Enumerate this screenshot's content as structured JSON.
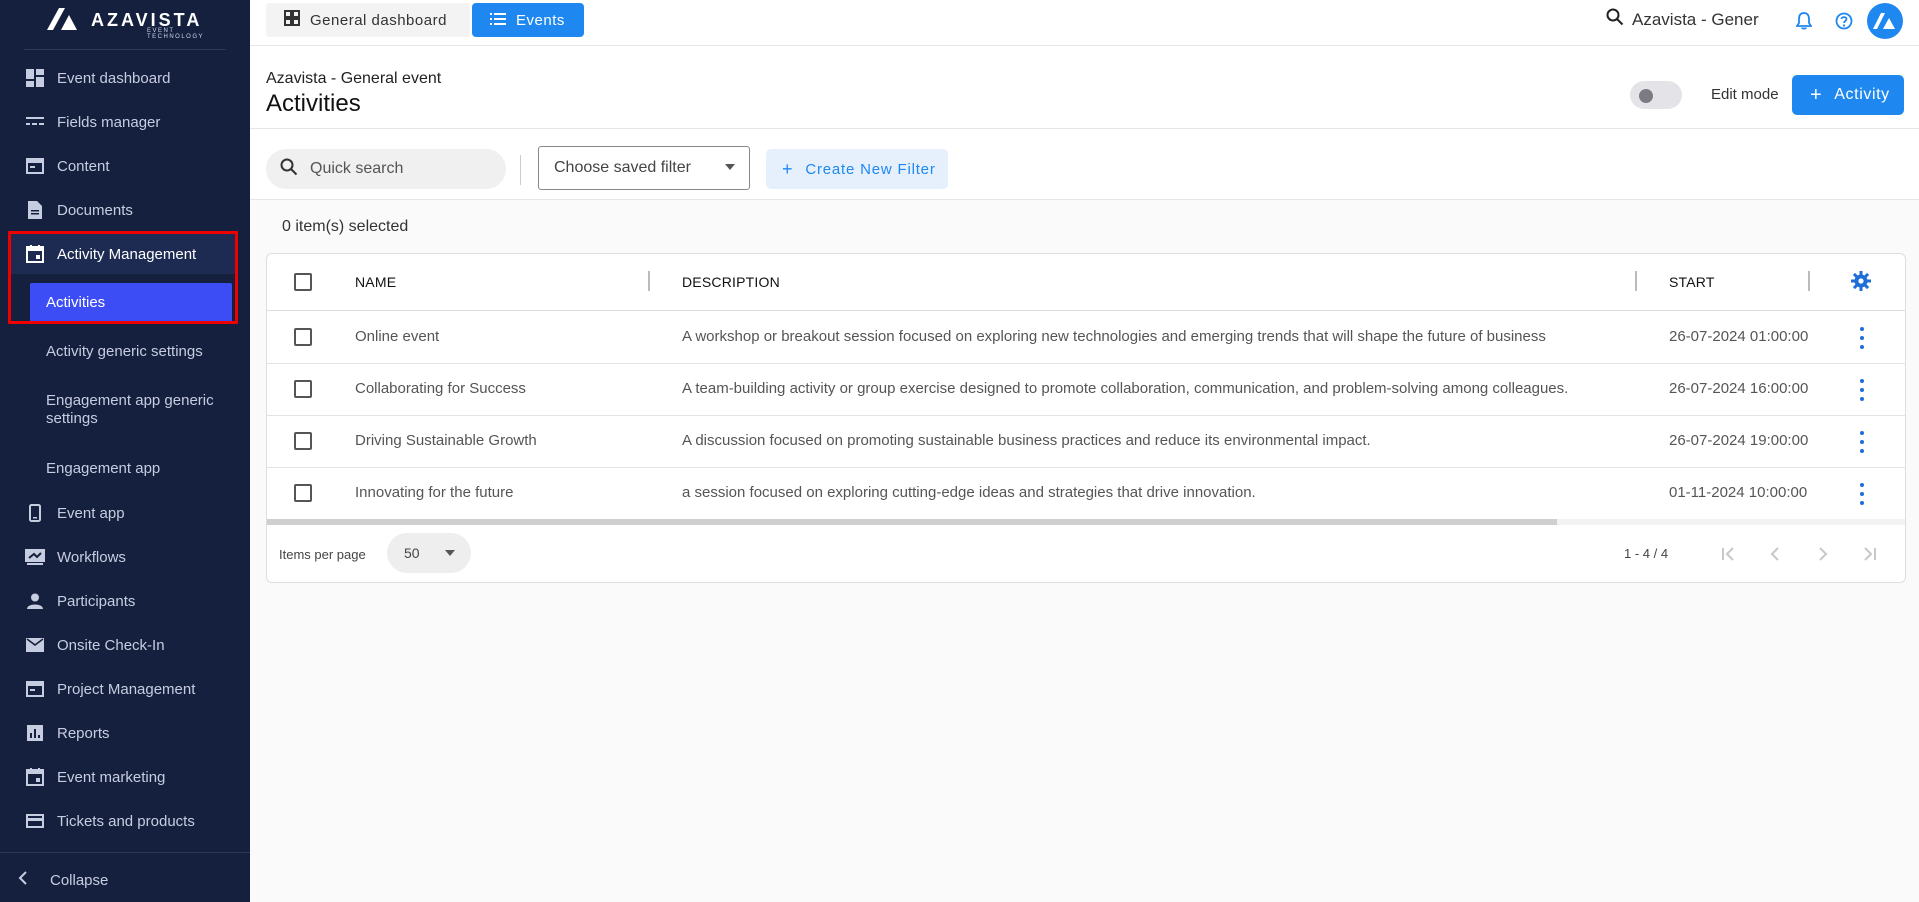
{
  "logo": {
    "word": "AZAVISTA",
    "sub": "EVENT TECHNOLOGY"
  },
  "sidebar": {
    "items": [
      {
        "label": "Event dashboard",
        "icon": "dashboard-icon"
      },
      {
        "label": "Fields manager",
        "icon": "fields-icon"
      },
      {
        "label": "Content",
        "icon": "content-icon"
      },
      {
        "label": "Documents",
        "icon": "document-icon"
      },
      {
        "label": "Activity Management",
        "icon": "calendar-icon"
      },
      {
        "label": "Event app",
        "icon": "phone-icon"
      },
      {
        "label": "Workflows",
        "icon": "workflow-icon"
      },
      {
        "label": "Participants",
        "icon": "person-icon"
      },
      {
        "label": "Onsite Check-In",
        "icon": "mail-icon"
      },
      {
        "label": "Project Management",
        "icon": "project-icon"
      },
      {
        "label": "Reports",
        "icon": "chart-icon"
      },
      {
        "label": "Event marketing",
        "icon": "calendar-icon"
      },
      {
        "label": "Tickets and products",
        "icon": "card-icon"
      }
    ],
    "sub_items": [
      {
        "label": "Activities"
      },
      {
        "label": "Activity generic settings"
      },
      {
        "label": "Engagement app generic settings"
      },
      {
        "label": "Engagement app"
      }
    ],
    "collapse_label": "Collapse"
  },
  "topbar": {
    "general_tab": "General dashboard",
    "events_tab": "Events",
    "search_text": "Azavista - Gener"
  },
  "header": {
    "event_name": "Azavista - General event",
    "title": "Activities",
    "edit_mode_label": "Edit mode",
    "add_button_label": "Activity"
  },
  "filters": {
    "search_placeholder": "Quick search",
    "saved_filter_placeholder": "Choose saved filter",
    "new_filter_label": "Create New Filter"
  },
  "table": {
    "selected_text": "0 item(s) selected",
    "columns": {
      "name": "NAME",
      "description": "DESCRIPTION",
      "start": "START"
    },
    "rows": [
      {
        "name": "Online event",
        "description": "A workshop or breakout session focused on exploring new technologies and emerging trends that will shape the future of business",
        "start": "26-07-2024 01:00:00"
      },
      {
        "name": "Collaborating for Success",
        "description": "A team-building activity or group exercise designed to promote collaboration, communication, and problem-solving among colleagues.",
        "start": "26-07-2024 16:00:00"
      },
      {
        "name": "Driving Sustainable Growth",
        "description": "A discussion focused on promoting sustainable business practices and reduce its environmental impact.",
        "start": "26-07-2024 19:00:00"
      },
      {
        "name": "Innovating for the future",
        "description": "a session focused on exploring cutting-edge ideas and strategies that drive innovation.",
        "start": "01-11-2024 10:00:00"
      }
    ]
  },
  "pagination": {
    "items_per_page_label": "Items per page",
    "items_per_page_value": "50",
    "range_text": "1 - 4 / 4"
  },
  "colors": {
    "sidebar_bg": "#15203f",
    "accent": "#1e88f0",
    "active_sub": "#3d4df5",
    "highlight": "#ee0000"
  }
}
